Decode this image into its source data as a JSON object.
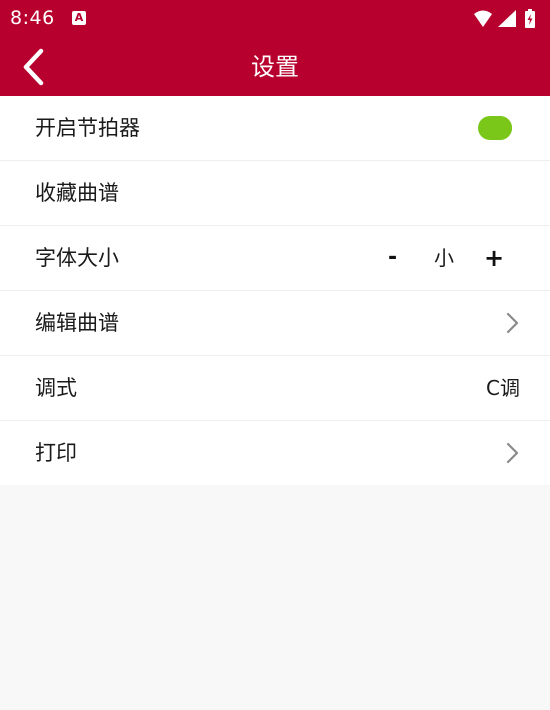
{
  "status_bar": {
    "time": "8:46",
    "app_icon_letter": "A",
    "icons": [
      "wifi-icon",
      "signal-icon",
      "battery-charging-icon"
    ]
  },
  "app_bar": {
    "title": "设置",
    "back_icon": "chevron-left-icon"
  },
  "colors": {
    "primary": "#b8002e",
    "toggle_on": "#7ac619",
    "background": "#f8f8f8",
    "row_background": "#ffffff"
  },
  "settings": {
    "metronome": {
      "label": "开启节拍器",
      "enabled": true
    },
    "favorite": {
      "label": "收藏曲谱"
    },
    "font_size": {
      "label": "字体大小",
      "decrease": "-",
      "value": "小",
      "increase": "+"
    },
    "edit_score": {
      "label": "编辑曲谱",
      "icon": "chevron-right-icon"
    },
    "key": {
      "label": "调式",
      "value": "C调"
    },
    "print": {
      "label": "打印",
      "icon": "chevron-right-icon"
    }
  }
}
